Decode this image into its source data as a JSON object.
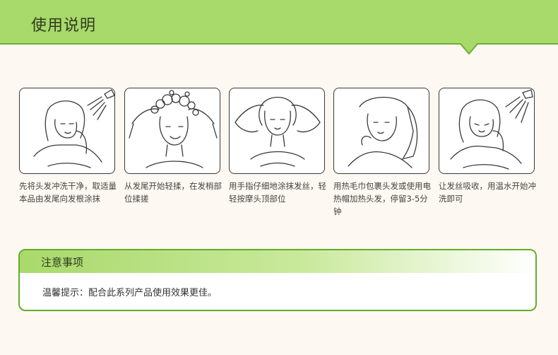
{
  "header": {
    "title": "使用说明",
    "colors": {
      "band": "#a7d96b",
      "stroke": "#6bb02f"
    }
  },
  "steps": [
    {
      "illustration": "rinse-hair-shower-illustration",
      "text": "先将头发冲洗干净，取适量本品由发尾向发根涂抹"
    },
    {
      "illustration": "lather-hair-illustration",
      "text": "从发尾开始轻揉，在发梢部位揉搓"
    },
    {
      "illustration": "massage-scalp-illustration",
      "text": "用手指仔细地涂抹发丝，轻轻按摩头顶部位"
    },
    {
      "illustration": "towel-wrap-illustration",
      "text": "用热毛巾包裹头发或使用电热帽加热头发，停留3-5分钟"
    },
    {
      "illustration": "warm-water-rinse-illustration",
      "text": "让发丝吸收，用温水开始冲洗即可"
    }
  ],
  "notice": {
    "title": "注意事项",
    "text": "温馨提示：配合此系列产品使用效果更佳。",
    "colors": {
      "border": "#63ad2a",
      "bar": "#a9d96b"
    }
  }
}
